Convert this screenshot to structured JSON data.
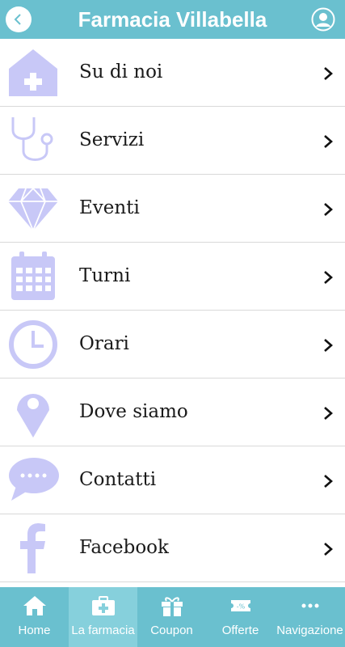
{
  "header": {
    "title": "Farmacia Villabella",
    "back_icon": "chevron-left-icon",
    "user_icon": "user-icon"
  },
  "colors": {
    "header_bg": "#6ac0cf",
    "active_tab_bg": "#86d0dc",
    "icon_color": "#c8c8f7",
    "text": "#1a1a1a",
    "divider": "#d9d9d9"
  },
  "menu": {
    "items": [
      {
        "label": "Su di noi",
        "icon": "house-plus-icon"
      },
      {
        "label": "Servizi",
        "icon": "stethoscope-icon"
      },
      {
        "label": "Eventi",
        "icon": "diamond-icon"
      },
      {
        "label": "Turni",
        "icon": "calendar-icon"
      },
      {
        "label": "Orari",
        "icon": "clock-icon"
      },
      {
        "label": "Dove siamo",
        "icon": "location-pin-icon"
      },
      {
        "label": "Contatti",
        "icon": "chat-bubble-icon"
      },
      {
        "label": "Facebook",
        "icon": "facebook-icon"
      }
    ]
  },
  "tabbar": {
    "active_index": 1,
    "tabs": [
      {
        "label": "Home",
        "icon": "home-icon"
      },
      {
        "label": "La farmacia",
        "icon": "medical-kit-icon"
      },
      {
        "label": "Coupon",
        "icon": "gift-icon"
      },
      {
        "label": "Offerte",
        "icon": "discount-ticket-icon"
      },
      {
        "label": "Navigazione",
        "icon": "more-dots-icon"
      }
    ]
  }
}
